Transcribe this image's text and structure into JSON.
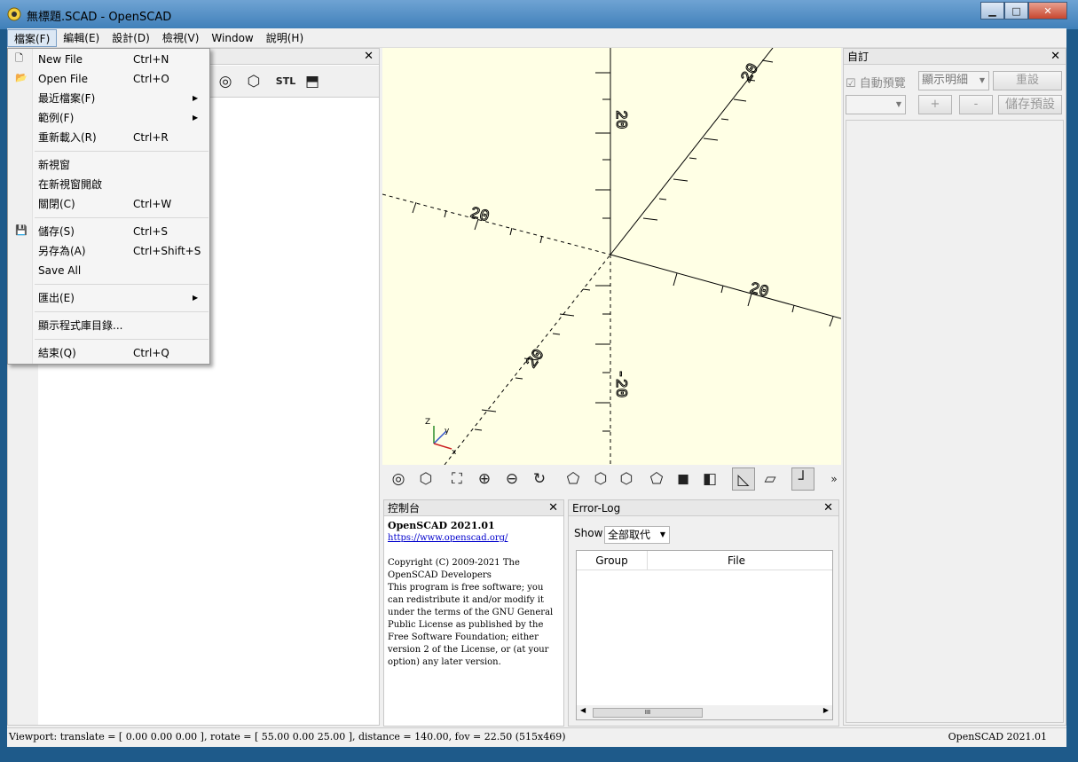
{
  "window": {
    "title": "無標題.SCAD - OpenSCAD",
    "minimize": "▁",
    "maximize": "□",
    "close": "✕"
  },
  "menubar": [
    "檔案(F)",
    "編輯(E)",
    "設計(D)",
    "檢視(V)",
    "Window",
    "說明(H)"
  ],
  "file_menu": [
    {
      "label": "New File",
      "shortcut": "Ctrl+N",
      "icon": "new-file-icon"
    },
    {
      "label": "Open File",
      "shortcut": "Ctrl+O",
      "icon": "open-folder-icon"
    },
    {
      "label": "最近檔案(F)",
      "submenu": true
    },
    {
      "label": "範例(F)",
      "submenu": true
    },
    {
      "label": "重新載入(R)",
      "shortcut": "Ctrl+R"
    },
    {
      "label": "新視窗"
    },
    {
      "label": "在新視窗開啟"
    },
    {
      "label": "關閉(C)",
      "shortcut": "Ctrl+W"
    },
    {
      "label": "儲存(S)",
      "shortcut": "Ctrl+S",
      "icon": "save-icon"
    },
    {
      "label": "另存為(A)",
      "shortcut": "Ctrl+Shift+S"
    },
    {
      "label": "Save All"
    },
    {
      "label": "匯出(E)",
      "submenu": true
    },
    {
      "label": "顯示程式庫目錄..."
    },
    {
      "label": "結束(Q)",
      "shortcut": "Ctrl+Q"
    }
  ],
  "editor": {
    "close": "✕",
    "stl_label": "STL"
  },
  "viewport": {
    "background": "#ffffe5",
    "axis_labels": [
      "20",
      "20",
      "20",
      "-20",
      "20",
      "20"
    ],
    "gizmo": {
      "z": "Z",
      "y": "y",
      "x": "x"
    }
  },
  "customizer": {
    "title": "自訂",
    "close": "✕",
    "auto_preview": "自動預覽",
    "detail": "顯示明細",
    "reset": "重設",
    "plus": "+",
    "minus": "-",
    "save_preset": "儲存預設"
  },
  "console": {
    "title": "控制台",
    "close": "✕",
    "heading": "OpenSCAD 2021.01",
    "link": "https://www.openscad.org/",
    "copyright": "Copyright (C) 2009-2021 The OpenSCAD Developers",
    "license": "This program is free software; you can redistribute it and/or modify it under the terms of the GNU General Public License as published by the Free Software Foundation; either version 2 of the License, or (at your option) any later version."
  },
  "errorlog": {
    "title": "Error-Log",
    "close": "✕",
    "show_label": "Show",
    "filter": "全部取代",
    "columns": [
      "Group",
      "File"
    ],
    "scroll_grip": "III"
  },
  "status": {
    "viewport": "Viewport: translate = [ 0.00 0.00 0.00 ], rotate = [ 55.00 0.00 25.00 ], distance = 140.00, fov = 22.50 (515x469)",
    "version": "OpenSCAD 2021.01"
  },
  "view_toolbar_more": "»"
}
